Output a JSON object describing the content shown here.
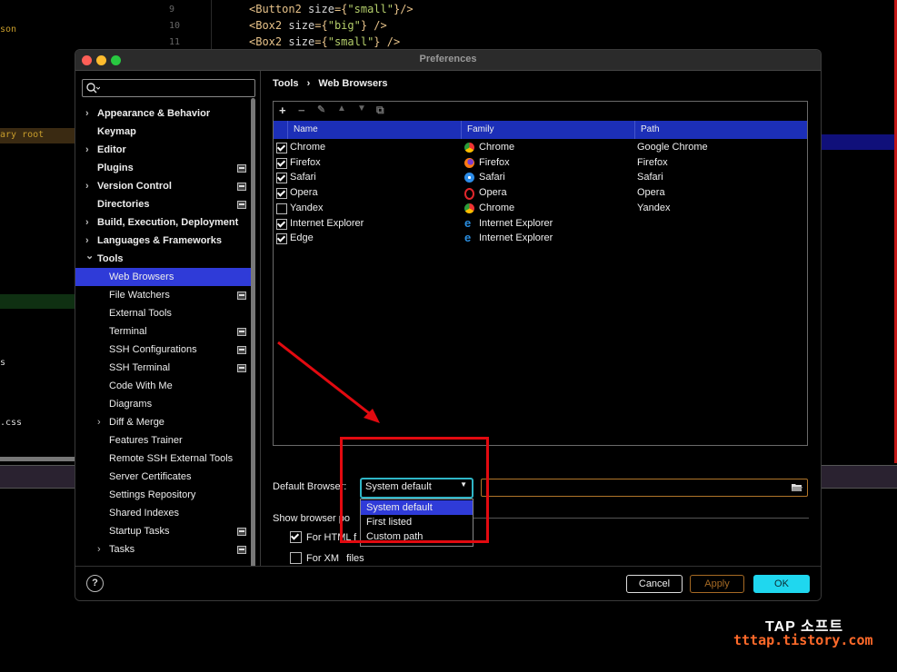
{
  "background": {
    "line_numbers": [
      "9",
      "10",
      "11"
    ],
    "code_lines": [
      {
        "tag": "<Button2 ",
        "attr": "size",
        "eq": "={",
        "str": "\"small\"",
        "end": "}/>"
      },
      {
        "tag": "<Box2 ",
        "attr": "size",
        "eq": "={",
        "str": "\"big\"",
        "end": "} />"
      },
      {
        "tag": "<Box2 ",
        "attr": "size",
        "eq": "={",
        "str": "\"small\"",
        "end": "} />"
      }
    ],
    "left_fragments": {
      "son": "son",
      "ary_root": "ary root",
      "s": "s",
      "css": ".css"
    }
  },
  "window": {
    "title": "Preferences"
  },
  "sidebar": {
    "search_placeholder": "",
    "items": [
      {
        "label": "Appearance & Behavior",
        "bold": true,
        "chevron": "›",
        "indent": 0,
        "icon": false
      },
      {
        "label": "Keymap",
        "bold": true,
        "chevron": "",
        "indent": 0,
        "icon": false
      },
      {
        "label": "Editor",
        "bold": true,
        "chevron": "›",
        "indent": 0,
        "icon": false
      },
      {
        "label": "Plugins",
        "bold": true,
        "chevron": "",
        "indent": 0,
        "icon": true
      },
      {
        "label": "Version Control",
        "bold": true,
        "chevron": "›",
        "indent": 0,
        "icon": true
      },
      {
        "label": "Directories",
        "bold": true,
        "chevron": "",
        "indent": 0,
        "icon": true
      },
      {
        "label": "Build, Execution, Deployment",
        "bold": true,
        "chevron": "›",
        "indent": 0,
        "icon": false
      },
      {
        "label": "Languages & Frameworks",
        "bold": true,
        "chevron": "›",
        "indent": 0,
        "icon": false
      },
      {
        "label": "Tools",
        "bold": true,
        "chevron": "⌄",
        "indent": 0,
        "icon": false
      },
      {
        "label": "Web Browsers",
        "bold": false,
        "chevron": "",
        "indent": 1,
        "icon": false,
        "selected": true
      },
      {
        "label": "File Watchers",
        "bold": false,
        "chevron": "",
        "indent": 1,
        "icon": true
      },
      {
        "label": "External Tools",
        "bold": false,
        "chevron": "",
        "indent": 1,
        "icon": false
      },
      {
        "label": "Terminal",
        "bold": false,
        "chevron": "",
        "indent": 1,
        "icon": true
      },
      {
        "label": "SSH Configurations",
        "bold": false,
        "chevron": "",
        "indent": 1,
        "icon": true
      },
      {
        "label": "SSH Terminal",
        "bold": false,
        "chevron": "",
        "indent": 1,
        "icon": true
      },
      {
        "label": "Code With Me",
        "bold": false,
        "chevron": "",
        "indent": 1,
        "icon": false
      },
      {
        "label": "Diagrams",
        "bold": false,
        "chevron": "",
        "indent": 1,
        "icon": false
      },
      {
        "label": "Diff & Merge",
        "bold": false,
        "chevron": "›",
        "indent": 1,
        "icon": false
      },
      {
        "label": "Features Trainer",
        "bold": false,
        "chevron": "",
        "indent": 1,
        "icon": false
      },
      {
        "label": "Remote SSH External Tools",
        "bold": false,
        "chevron": "",
        "indent": 1,
        "icon": false
      },
      {
        "label": "Server Certificates",
        "bold": false,
        "chevron": "",
        "indent": 1,
        "icon": false
      },
      {
        "label": "Settings Repository",
        "bold": false,
        "chevron": "",
        "indent": 1,
        "icon": false
      },
      {
        "label": "Shared Indexes",
        "bold": false,
        "chevron": "",
        "indent": 1,
        "icon": false
      },
      {
        "label": "Startup Tasks",
        "bold": false,
        "chevron": "",
        "indent": 1,
        "icon": true
      },
      {
        "label": "Tasks",
        "bold": false,
        "chevron": "›",
        "indent": 1,
        "icon": true
      }
    ]
  },
  "breadcrumb": {
    "root": "Tools",
    "separator": "›",
    "leaf": "Web Browsers"
  },
  "toolbar": {
    "add": "+",
    "remove": "−",
    "edit": "✎",
    "up": "▲",
    "down": "▼",
    "copy": "⧉"
  },
  "table": {
    "headers": [
      "Name",
      "Family",
      "Path"
    ],
    "rows": [
      {
        "checked": true,
        "name": "Chrome",
        "family": "Chrome",
        "family_icon": "chrome-icon",
        "path": "Google Chrome"
      },
      {
        "checked": true,
        "name": "Firefox",
        "family": "Firefox",
        "family_icon": "firefox-icon",
        "path": "Firefox"
      },
      {
        "checked": true,
        "name": "Safari",
        "family": "Safari",
        "family_icon": "safari-icon",
        "path": "Safari"
      },
      {
        "checked": true,
        "name": "Opera",
        "family": "Opera",
        "family_icon": "opera-icon",
        "path": "Opera"
      },
      {
        "checked": false,
        "name": "Yandex",
        "family": "Chrome",
        "family_icon": "chrome-icon",
        "path": "Yandex"
      },
      {
        "checked": true,
        "name": "Internet Explorer",
        "family": "Internet Explorer",
        "family_icon": "ie-icon",
        "path": ""
      },
      {
        "checked": true,
        "name": "Edge",
        "family": "Internet Explorer",
        "family_icon": "ie-icon",
        "path": ""
      }
    ]
  },
  "default_browser": {
    "label": "Default Browser:",
    "value": "System default",
    "options": [
      "System default",
      "First listed",
      "Custom path"
    ],
    "path_value": ""
  },
  "popup_section": {
    "label": "Show browser po",
    "html_label": "For HTML f",
    "html_checked": true,
    "xml_label": "For XM",
    "xml_suffix": "files",
    "xml_checked": false
  },
  "footer": {
    "help": "?",
    "cancel": "Cancel",
    "apply": "Apply",
    "ok": "OK"
  },
  "watermark": {
    "line1": "TAP 소프트",
    "line2": "tttap.tistory.com"
  },
  "colors": {
    "selection": "#2f3bd8",
    "header": "#1c2fb8",
    "ok": "#1fd7ef",
    "annotation": "#e20a10",
    "focus": "#2fb6c7"
  }
}
